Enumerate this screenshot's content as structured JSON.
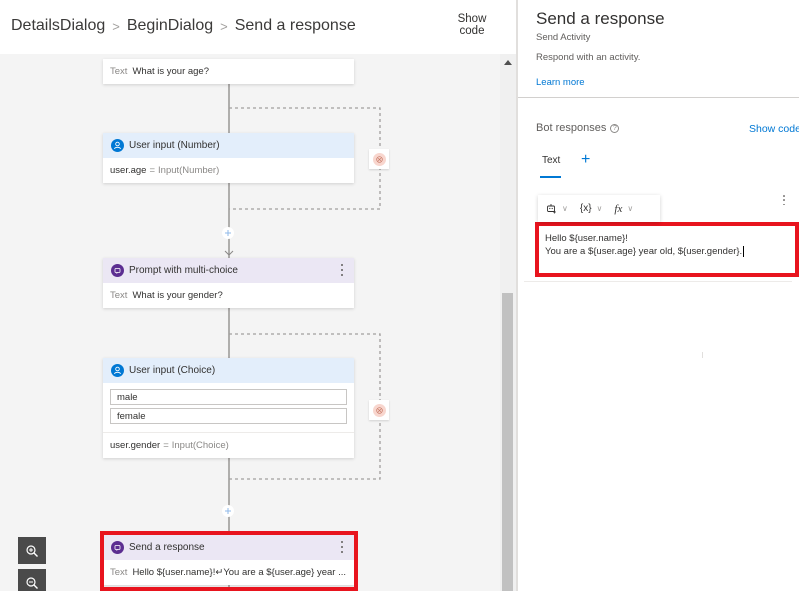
{
  "breadcrumb": {
    "items": [
      "DetailsDialog",
      "BeginDialog",
      "Send a response"
    ],
    "separator": ">"
  },
  "header": {
    "show_code_line1": "Show",
    "show_code_line2": "code"
  },
  "canvas": {
    "nodes": {
      "age_prompt_text": {
        "label": "Text",
        "value": "What is your age?"
      },
      "number_input": {
        "title": "User input (Number)",
        "property": "user.age",
        "equals": "=",
        "expression": "Input(Number)"
      },
      "gender_prompt": {
        "title": "Prompt with multi-choice",
        "label": "Text",
        "value": "What is your gender?"
      },
      "choice_input": {
        "title": "User input (Choice)",
        "choices": [
          "male",
          "female"
        ],
        "property": "user.gender",
        "equals": "=",
        "expression": "Input(Choice)"
      },
      "send_response": {
        "title": "Send a response",
        "label": "Text",
        "value": "Hello ${user.name}!↵You are a ${user.age} year ..."
      }
    }
  },
  "properties_panel": {
    "title": "Send a response",
    "subtitle": "Send Activity",
    "description": "Respond with an activity.",
    "learn_more": "Learn more",
    "bot_responses_label": "Bot responses",
    "help_glyph": "?",
    "show_code": "Show code",
    "tabs": [
      {
        "label": "Text",
        "active": true
      }
    ],
    "add_tab_glyph": "+",
    "toolbar": {
      "template_icon": "bot-template-icon",
      "variable_label": "{x}",
      "function_label": "fx"
    },
    "editor": {
      "line1": "Hello ${user.name}!",
      "line2": "You are a ${user.age} year old, ${user.gender}."
    }
  },
  "colors": {
    "accent": "#0078d4",
    "highlight": "#e8141e",
    "user_input_header": "#e3eefb",
    "prompt_header": "#ebe7f4",
    "error_badge": "#f8d6ce"
  }
}
